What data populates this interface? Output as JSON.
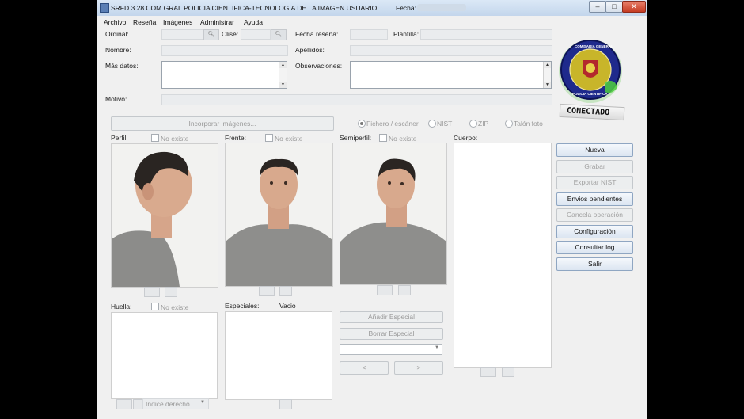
{
  "window": {
    "title": "SRFD 3.28  COM.GRAL.POLICIA CIENTIFICA-TECNOLOGIA DE LA IMAGEN    USUARIO:",
    "fecha_label": "Fecha:",
    "minimize": "–",
    "maximize": "□",
    "close": "✕"
  },
  "menu": [
    "Archivo",
    "Reseña",
    "Imágenes",
    "Administrar",
    "Ayuda"
  ],
  "form": {
    "ordinal_label": "Ordinal:",
    "clise_label": "Clisé:",
    "fecha_resena_label": "Fecha reseña:",
    "plantilla_label": "Plantilla:",
    "nombre_label": "Nombre:",
    "apellidos_label": "Apellidos:",
    "mas_datos_label": "Más datos:",
    "observaciones_label": "Observaciones:",
    "motivo_label": "Motivo:"
  },
  "logo": {
    "top_text": "COMISARIA GENERAL",
    "bottom_text": "POLICIA CIENTIFICA",
    "status": "CONECTADO",
    "colors": {
      "ring": "#1f2a8c",
      "inner": "#c8b52a",
      "status_glow": "#55d04a"
    }
  },
  "images": {
    "incorporar_button": "Incorporar imágenes...",
    "source_options": [
      "Fichero / escáner",
      "NIST",
      "ZIP",
      "Talón foto"
    ],
    "selected_source": "Fichero / escáner",
    "no_existe": "No existe",
    "perfil_label": "Perfil:",
    "frente_label": "Frente:",
    "semiperfil_label": "Semiperfil:",
    "cuerpo_label": "Cuerpo:",
    "huella_label": "Huella:",
    "especiales_label": "Especiales:",
    "vacio_label": "Vacio",
    "finger_select": "Indice derecho"
  },
  "especiales": {
    "anadir": "Añadir Especial",
    "borrar": "Borrar Especial",
    "prev": "<",
    "next": ">"
  },
  "actions": {
    "nueva": "Nueva",
    "grabar": "Grabar",
    "exportar_nist": "Exportar NIST",
    "envios_pendientes": "Envios pendientes",
    "cancela_operacion": "Cancela operación",
    "configuracion": "Configuración",
    "consultar_log": "Consultar log",
    "salir": "Salir"
  }
}
